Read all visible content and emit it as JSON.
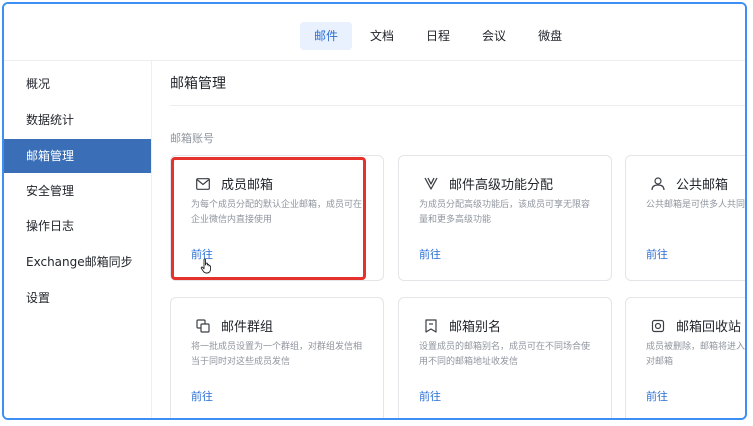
{
  "top_tabs": [
    {
      "label": "邮件",
      "active": true
    },
    {
      "label": "文档",
      "active": false
    },
    {
      "label": "日程",
      "active": false
    },
    {
      "label": "会议",
      "active": false
    },
    {
      "label": "微盘",
      "active": false
    }
  ],
  "sidebar": {
    "items": [
      {
        "label": "概况",
        "active": false
      },
      {
        "label": "数据统计",
        "active": false
      },
      {
        "label": "邮箱管理",
        "active": true
      },
      {
        "label": "安全管理",
        "active": false
      },
      {
        "label": "操作日志",
        "active": false
      },
      {
        "label": "Exchange邮箱同步",
        "active": false
      },
      {
        "label": "设置",
        "active": false
      }
    ]
  },
  "main": {
    "title": "邮箱管理",
    "section_label": "邮箱账号",
    "cards": [
      {
        "icon": "envelope-icon",
        "title": "成员邮箱",
        "desc": "为每个成员分配的默认企业邮箱，成员可在企业微信内直接使用",
        "link": "前往"
      },
      {
        "icon": "v-icon",
        "title": "邮件高级功能分配",
        "desc": "为成员分配高级功能后，该成员可享无限容量和更多高级功能",
        "link": "前往"
      },
      {
        "icon": "people-icon",
        "title": "公共邮箱",
        "desc": "公共邮箱是可供多人共同使",
        "link": "前往"
      },
      {
        "icon": "group-icon",
        "title": "邮件群组",
        "desc": "将一批成员设置为一个群组，对群组发信相当于同时对这些成员发信",
        "link": "前往"
      },
      {
        "icon": "bookmark-icon",
        "title": "邮箱别名",
        "desc": "设置成员的邮箱别名，成员可在不同场合使用不同的邮箱地址收发信",
        "link": "前往"
      },
      {
        "icon": "recycle-icon",
        "title": "邮箱回收站",
        "desc": "成员被删除，邮箱将进入时间，管理员可以对邮箱",
        "link": "前往"
      }
    ]
  },
  "colors": {
    "accent": "#2b6fd6",
    "sidebar_active": "#3a6fb8",
    "highlight": "#e5322d"
  }
}
